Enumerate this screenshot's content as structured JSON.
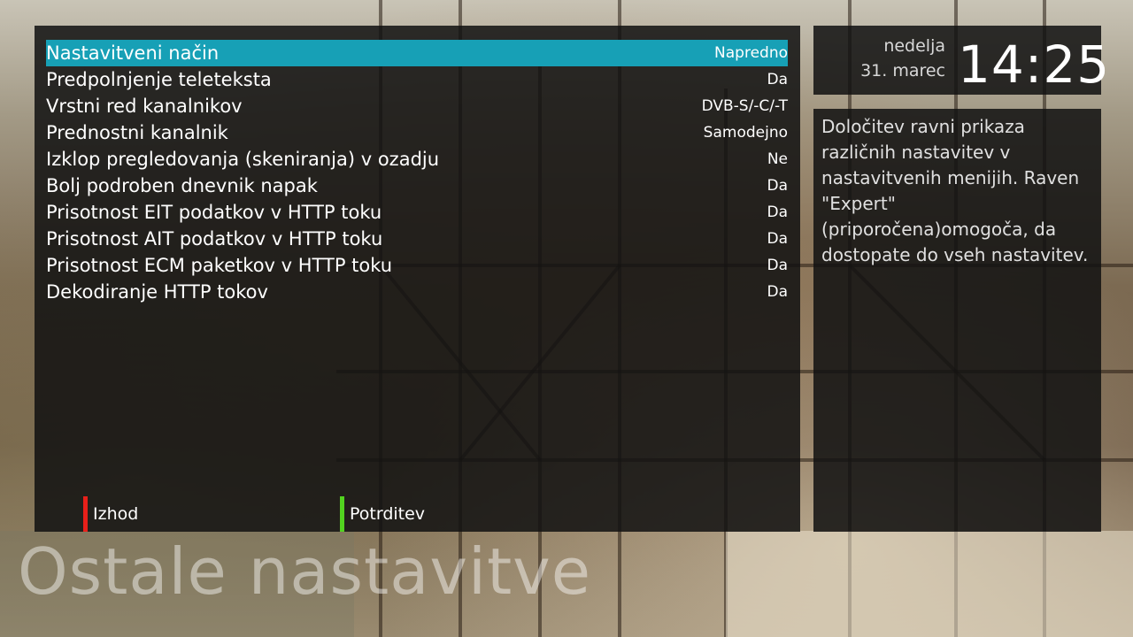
{
  "screen_title": "Ostale nastavitve",
  "settings": [
    {
      "label": "Nastavitveni način",
      "value": "Napredno"
    },
    {
      "label": "Predpolnjenje teleteksta",
      "value": "Da"
    },
    {
      "label": "Vrstni red kanalnikov",
      "value": "DVB-S/-C/-T"
    },
    {
      "label": "Prednostni kanalnik",
      "value": "Samodejno"
    },
    {
      "label": "Izklop pregledovanja (skeniranja) v ozadju",
      "value": "Ne"
    },
    {
      "label": "Bolj podroben dnevnik napak",
      "value": "Da"
    },
    {
      "label": "Prisotnost EIT podatkov v HTTP toku",
      "value": "Da"
    },
    {
      "label": "Prisotnost AIT podatkov v HTTP toku",
      "value": "Da"
    },
    {
      "label": "Prisotnost ECM paketkov v HTTP toku",
      "value": "Da"
    },
    {
      "label": "Dekodiranje HTTP tokov",
      "value": "Da"
    }
  ],
  "buttons": {
    "red": {
      "label": "Izhod",
      "color": "#e8201a"
    },
    "green": {
      "label": "Potrditev",
      "color": "#52d31f"
    }
  },
  "clock": {
    "weekday": "nedelja",
    "date": "31. marec",
    "time": "14:25"
  },
  "description": "Določitev ravni prikaza različnih nastavitev v nastavitvenih menijih. Raven \"Expert\" (priporočena)omogoča, da dostopate do vseh nastavitev.",
  "colors": {
    "selection": "#17a0b6",
    "panel": "#121212"
  }
}
